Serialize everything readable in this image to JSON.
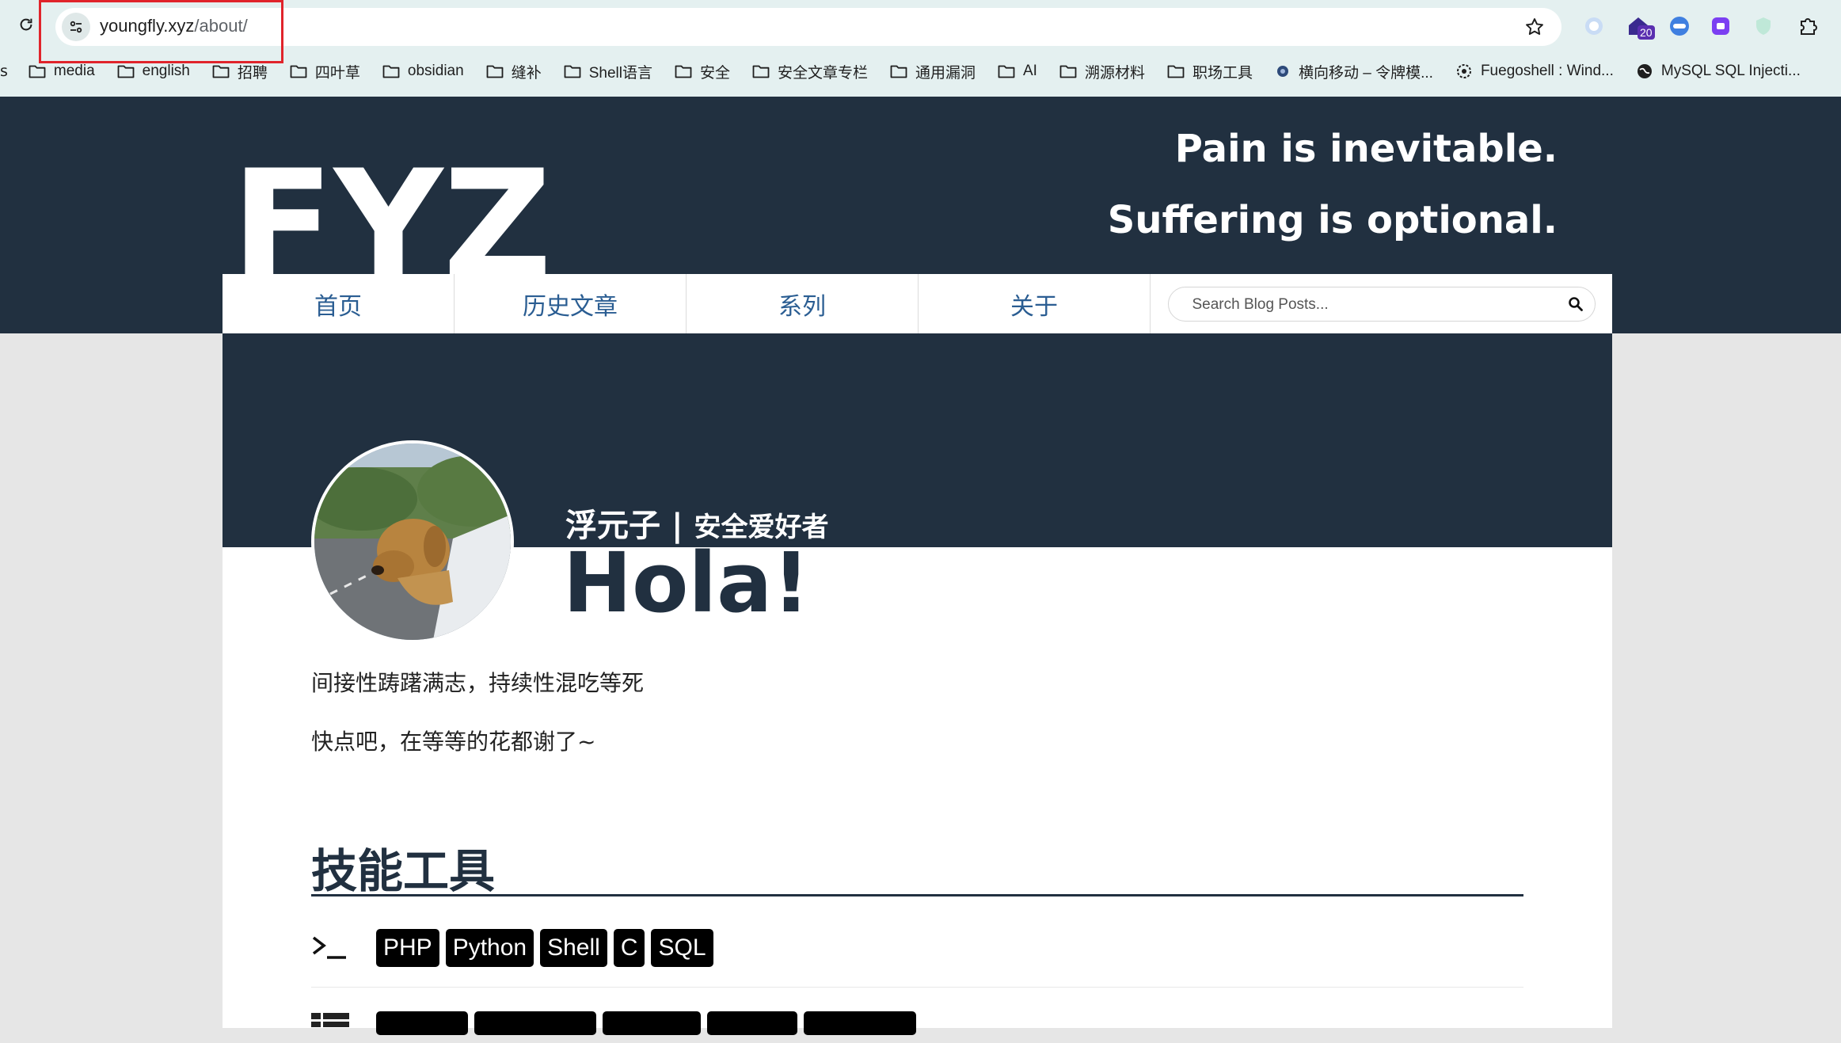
{
  "browser": {
    "url_host": "youngfly.xyz",
    "url_path": "/about/",
    "extension_badge": "20",
    "bookmarks_cut": "s",
    "bookmarks": [
      {
        "label": "media",
        "icon": "folder-icon"
      },
      {
        "label": "english",
        "icon": "folder-icon"
      },
      {
        "label": "招聘",
        "icon": "folder-icon"
      },
      {
        "label": "四叶草",
        "icon": "folder-icon"
      },
      {
        "label": "obsidian",
        "icon": "folder-icon"
      },
      {
        "label": "缝补",
        "icon": "folder-icon"
      },
      {
        "label": "Shell语言",
        "icon": "folder-icon"
      },
      {
        "label": "安全",
        "icon": "folder-icon"
      },
      {
        "label": "安全文章专栏",
        "icon": "folder-icon"
      },
      {
        "label": "通用漏洞",
        "icon": "folder-icon"
      },
      {
        "label": "AI",
        "icon": "folder-icon"
      },
      {
        "label": "溯源材料",
        "icon": "folder-icon"
      },
      {
        "label": "职场工具",
        "icon": "folder-icon"
      },
      {
        "label": "横向移动 – 令牌模...",
        "icon": "site-icon"
      },
      {
        "label": "Fuegoshell : Wind...",
        "icon": "gear-site-icon"
      },
      {
        "label": "MySQL SQL Injecti...",
        "icon": "globe-icon"
      }
    ]
  },
  "site": {
    "logo_text": "FYZ",
    "tagline_1": "Pain is inevitable.",
    "tagline_2": "Suffering is optional.",
    "nav": [
      "首页",
      "历史文章",
      "系列",
      "关于"
    ],
    "search_placeholder": "Search Blog Posts..."
  },
  "about": {
    "name": "浮元子",
    "separator": "|",
    "role": "安全爱好者",
    "greeting": "Hola!",
    "line_1": "间接性踌躇满志，持续性混吃等死",
    "line_2": "快点吧，在等等的花都谢了~",
    "skills_title": "技能工具",
    "languages": [
      "PHP",
      "Python",
      "Shell",
      "C",
      "SQL"
    ]
  },
  "colors": {
    "brand_dark": "#213040",
    "nav_link": "#2a5d92",
    "highlight": "#e0242b"
  }
}
